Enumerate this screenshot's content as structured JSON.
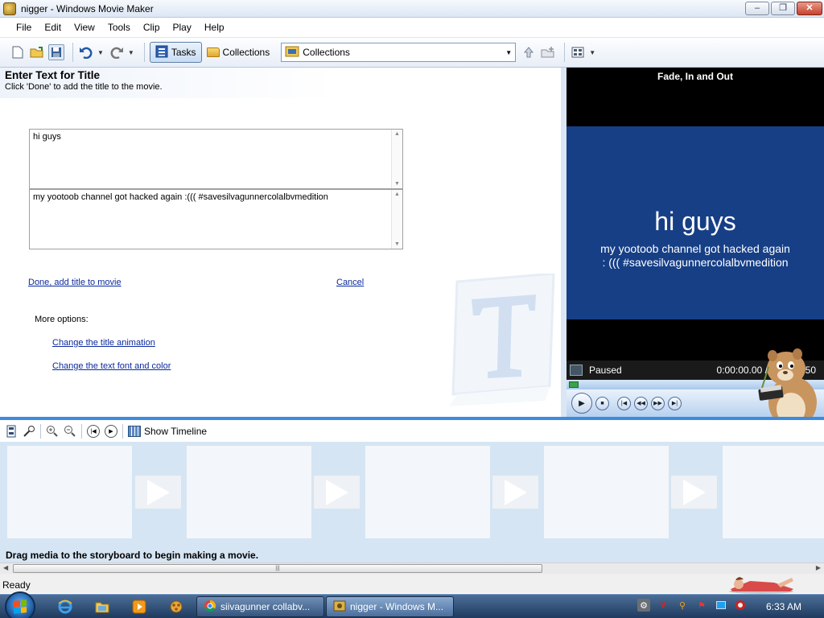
{
  "window": {
    "title": "nigger - Windows Movie Maker",
    "minimize": "–",
    "restore": "❐",
    "close": "✕"
  },
  "menu": [
    "File",
    "Edit",
    "View",
    "Tools",
    "Clip",
    "Play",
    "Help"
  ],
  "toolbar": {
    "tasks_label": "Tasks",
    "collections_label": "Collections",
    "collections_select": "Collections"
  },
  "title_task": {
    "heading": "Enter Text for Title",
    "subheading": "Click 'Done' to add the title to the movie.",
    "title_text": "hi guys",
    "subtitle_text": "my yootoob channel got hacked again :((( #savesilvagunnercolalbvmedition",
    "done_link": "Done, add title to movie",
    "cancel_link": "Cancel",
    "more_options": "More options:",
    "animation_link": "Change the title animation",
    "font_link": "Change the text font and color"
  },
  "preview": {
    "effect_name": "Fade, In and Out",
    "big_text": "hi guys",
    "small_text": "my yootoob channel got hacked again : (((  #savesilvagunnercolalbvmedition",
    "status": "Paused",
    "time": "0:00:00.00 / 0:00:03.50"
  },
  "storyboard": {
    "show_timeline": "Show Timeline",
    "hint": "Drag media to the storyboard to begin making a movie."
  },
  "status": "Ready",
  "taskbar": {
    "tasks": [
      "siivagunner collabv...",
      "nigger - Windows M..."
    ],
    "clock": "6:33 AM"
  }
}
